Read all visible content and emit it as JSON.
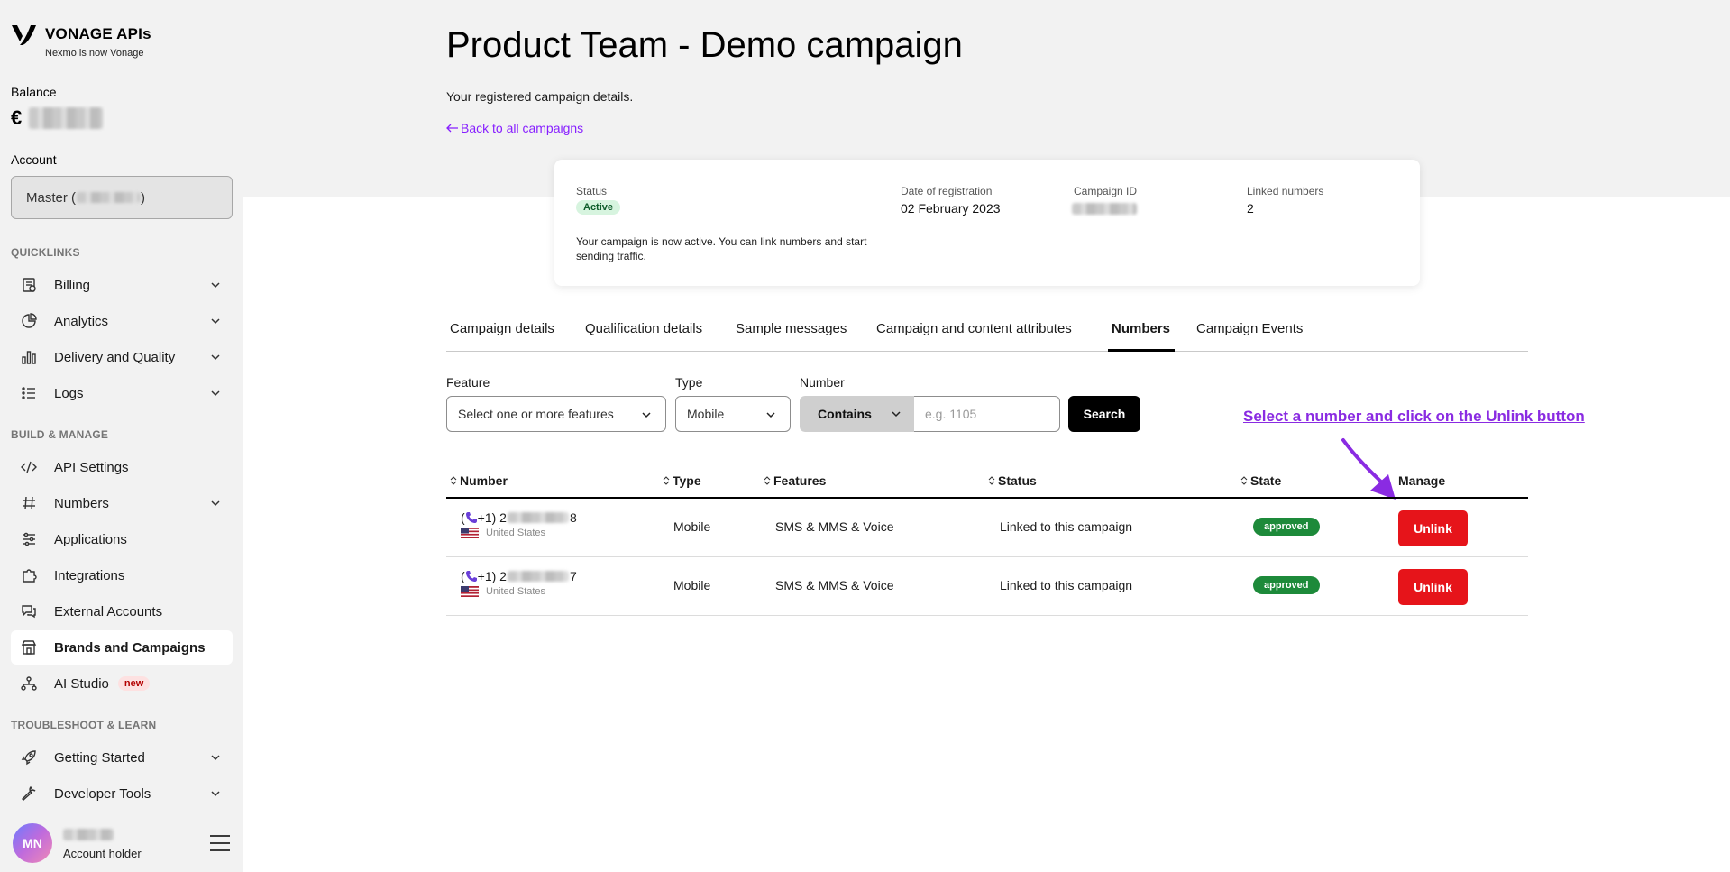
{
  "brand": {
    "title": "VONAGE APIs",
    "subtitle": "Nexmo is now Vonage"
  },
  "sidebar": {
    "balance_label": "Balance",
    "balance_currency": "€",
    "account_label": "Account",
    "account_value_prefix": "Master (",
    "account_value_suffix": ")",
    "sections": {
      "quicklinks": "QUICKLINKS",
      "build_manage": "BUILD & MANAGE",
      "troubleshoot": "TROUBLESHOOT & LEARN"
    },
    "items": {
      "billing": "Billing",
      "analytics": "Analytics",
      "delivery": "Delivery and Quality",
      "logs": "Logs",
      "api_settings": "API Settings",
      "numbers": "Numbers",
      "applications": "Applications",
      "integrations": "Integrations",
      "external_accounts": "External Accounts",
      "brands_campaigns": "Brands and Campaigns",
      "ai_studio": "AI Studio",
      "ai_studio_badge": "new",
      "getting_started": "Getting Started",
      "developer_tools": "Developer Tools"
    },
    "user": {
      "initials": "MN",
      "role": "Account holder"
    }
  },
  "page": {
    "title": "Product Team - Demo campaign",
    "subtitle": "Your registered campaign details.",
    "back_link": "Back to all campaigns"
  },
  "card": {
    "status_label": "Status",
    "status_value": "Active",
    "note": "Your campaign is now active. You can link numbers and start sending traffic.",
    "registration_label": "Date of registration",
    "registration_value": "02 February 2023",
    "campaign_id_label": "Campaign ID",
    "linked_label": "Linked numbers",
    "linked_value": "2"
  },
  "tabs": {
    "campaign_details": "Campaign details",
    "qualification": "Qualification details",
    "sample_messages": "Sample messages",
    "attributes": "Campaign and content attributes",
    "numbers": "Numbers",
    "events": "Campaign Events"
  },
  "filters": {
    "feature_label": "Feature",
    "feature_placeholder": "Select one or more features",
    "type_label": "Type",
    "type_value": "Mobile",
    "number_label": "Number",
    "match_value": "Contains",
    "number_placeholder": "e.g. 1105",
    "search_label": "Search"
  },
  "annotation": "Select a number and click on the Unlink button",
  "table": {
    "headers": {
      "number": "Number",
      "type": "Type",
      "features": "Features",
      "status": "Status",
      "state": "State",
      "manage": "Manage"
    },
    "rows": [
      {
        "prefix": "+1) 2",
        "suffix": "8",
        "country": "United States",
        "type": "Mobile",
        "features": "SMS & MMS & Voice",
        "status": "Linked to this campaign",
        "state": "approved",
        "action": "Unlink"
      },
      {
        "prefix": "+1) 2",
        "suffix": "7",
        "country": "United States",
        "type": "Mobile",
        "features": "SMS & MMS & Voice",
        "status": "Linked to this campaign",
        "state": "approved",
        "action": "Unlink"
      }
    ]
  },
  "colors": {
    "accent_purple": "#871fff",
    "unlink_red": "#e6141a",
    "approved_green": "#1d8a3a",
    "annotation_purple": "#8a2be2"
  }
}
